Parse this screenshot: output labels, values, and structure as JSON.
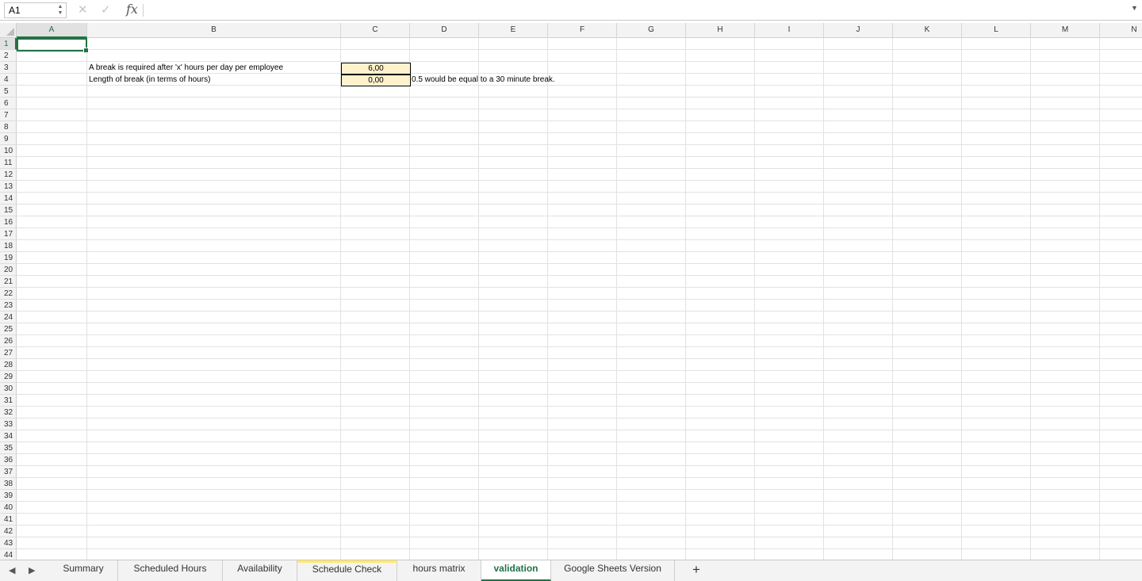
{
  "formula_bar": {
    "name_box": "A1",
    "cancel_glyph": "✕",
    "enter_glyph": "✓",
    "fx_label": "fx",
    "formula_value": ""
  },
  "columns": [
    "A",
    "B",
    "C",
    "D",
    "E",
    "F",
    "G",
    "H",
    "I",
    "J",
    "K",
    "L",
    "M",
    "N"
  ],
  "rows": [
    "1",
    "2",
    "3",
    "4",
    "5",
    "6",
    "7",
    "8",
    "9",
    "10",
    "11",
    "12",
    "13",
    "14",
    "15",
    "16",
    "17",
    "18",
    "19",
    "20",
    "21",
    "22",
    "23",
    "24",
    "25",
    "26",
    "27",
    "28",
    "29",
    "30",
    "31",
    "32",
    "33",
    "34",
    "35",
    "36",
    "37",
    "38",
    "39",
    "40",
    "41",
    "42",
    "43",
    "44"
  ],
  "active_cell": {
    "column": "A",
    "row": "1"
  },
  "cells": {
    "b3": "A break is required after 'x' hours per day per employee",
    "b4": "Length of break (in terms of hours)",
    "c3": "6,00",
    "c4": "0,00",
    "d4": "0.5 would be equal to a 30 minute break."
  },
  "sheet_tabs": [
    {
      "label": "Summary",
      "active": false
    },
    {
      "label": "Scheduled Hours",
      "active": false
    },
    {
      "label": "Availability",
      "active": false
    },
    {
      "label": "Schedule Check",
      "active": false,
      "tab_color": "#ffeb6b"
    },
    {
      "label": "hours matrix",
      "active": false
    },
    {
      "label": "validation",
      "active": true
    },
    {
      "label": "Google Sheets Version",
      "active": false
    }
  ],
  "add_sheet_glyph": "+",
  "icons": {
    "prev_sheet": "triangle-left-icon",
    "next_sheet": "triangle-right-icon",
    "expand_formula": "chevron-down-icon"
  },
  "colors": {
    "accent": "#217346",
    "input_cell_fill": "#fff2cc"
  }
}
